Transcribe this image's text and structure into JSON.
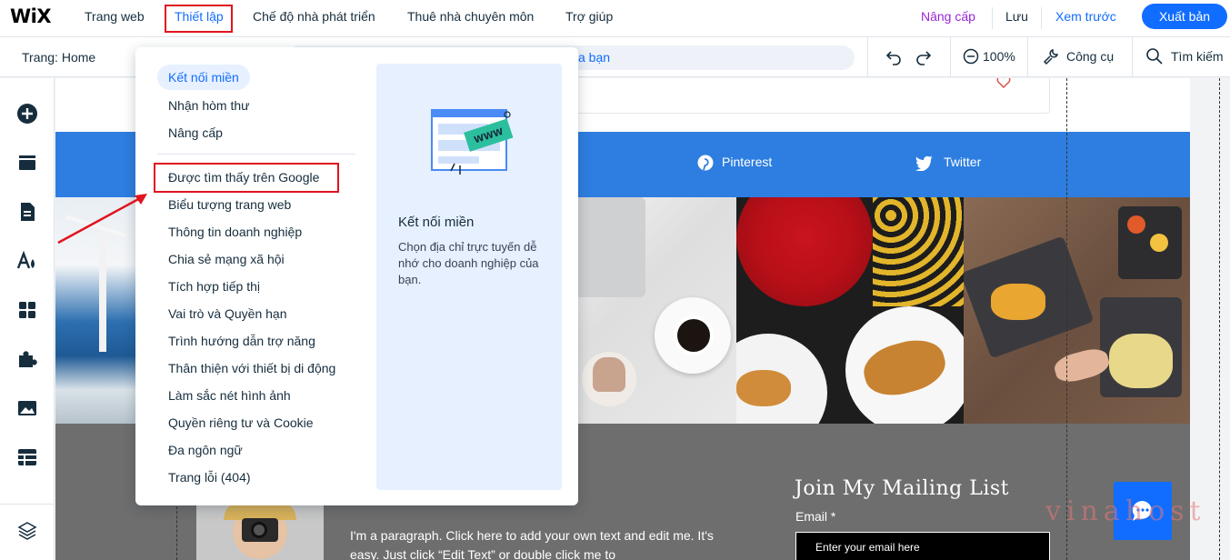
{
  "app": {
    "logo": "WiX"
  },
  "top_nav": {
    "items": [
      {
        "label": "Trang web"
      },
      {
        "label": "Thiết lập"
      },
      {
        "label": "Chế độ nhà phát triển"
      },
      {
        "label": "Thuê nhà chuyên môn"
      },
      {
        "label": "Trợ giúp"
      }
    ],
    "upgrade": "Nâng cấp",
    "save": "Lưu",
    "preview": "Xem trước",
    "publish": "Xuất bản"
  },
  "toolbar": {
    "page": "Trang: Home",
    "url_fragment": "a bạn",
    "zoom": "100%",
    "tools": "Công cụ",
    "search": "Tìm kiếm"
  },
  "dropdown": {
    "group1": [
      "Kết nối miền",
      "Nhận hòm thư",
      "Nâng cấp"
    ],
    "group2": [
      "Được tìm thấy trên Google",
      "Biểu tượng trang web",
      "Thông tin doanh nghiệp",
      "Chia sẻ mạng xã hội",
      "Tích hợp tiếp thị",
      "Vai trò và Quyền hạn",
      "Trình hướng dẫn trợ năng",
      "Thân thiện với thiết bị di động",
      "Làm sắc nét hình ảnh",
      "Quyền riêng tư và Cookie",
      "Đa ngôn ngữ",
      "Trang lỗi (404)"
    ],
    "info_title": "Kết nối miền",
    "info_desc": "Chọn địa chỉ trực tuyến dễ nhớ cho doanh nghiệp của bạn.",
    "illustration_text": "WWW"
  },
  "site": {
    "social": [
      "Pinterest",
      "Twitter"
    ],
    "mailing_title": "Join My Mailing List",
    "email_label": "Email *",
    "email_placeholder": "Enter your email here",
    "paragraph": "I'm a paragraph. Click here to add your own text and edit me. It's easy. Just click “Edit Text” or double click me to"
  },
  "watermark": "vinahost",
  "colors": {
    "accent": "#116dff",
    "strip": "#2d7ee0",
    "footer": "#6e6e6e",
    "highlight": "#e0141e"
  }
}
